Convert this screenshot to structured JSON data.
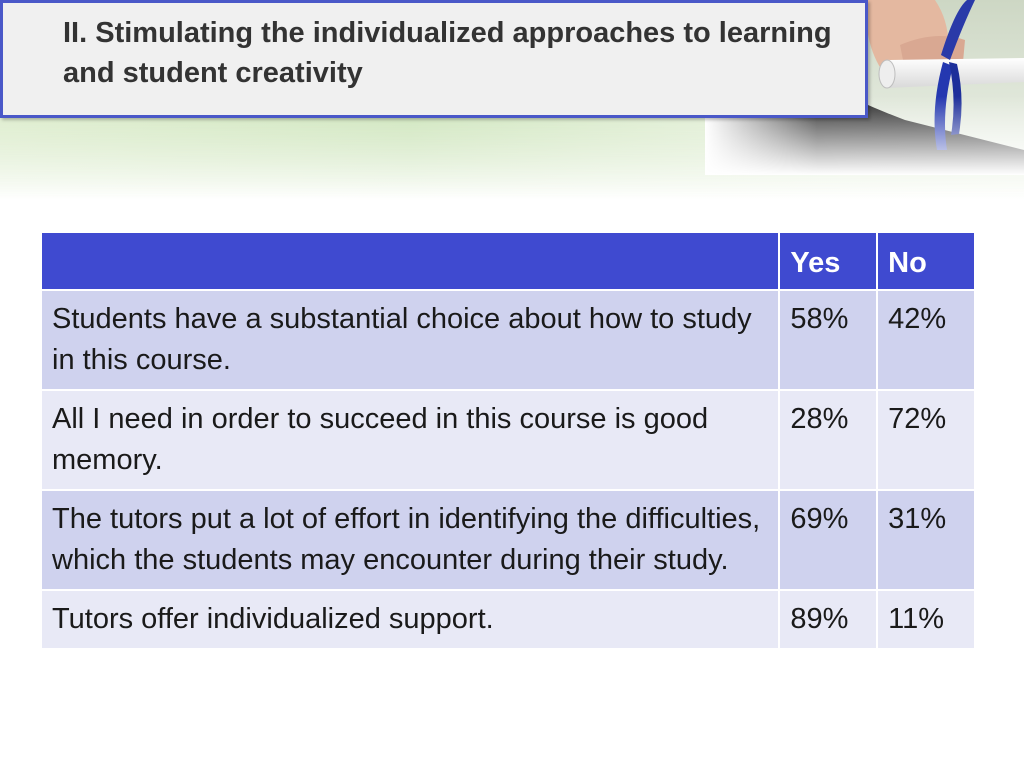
{
  "title": "II. Stimulating the individualized approaches to learning and student creativity",
  "table": {
    "headers": [
      "",
      "Yes",
      "No"
    ],
    "rows": [
      {
        "statement": "Students have a substantial choice about how to study in this course.",
        "yes": "58%",
        "no": "42%"
      },
      {
        "statement": "All I need in order to succeed in this course is good memory.",
        "yes": "28%",
        "no": "72%"
      },
      {
        "statement": "The tutors put a lot of effort in identifying the difficulties, which the students may encounter during their study.",
        "yes": "69%",
        "no": "31%"
      },
      {
        "statement": "Tutors offer individualized support.",
        "yes": "89%",
        "no": "11%"
      }
    ]
  },
  "colors": {
    "header_bg": "#3f4ad0",
    "row_dark": "#cfd2ee",
    "row_light": "#e8e9f6",
    "title_border": "#4a58c8"
  },
  "icons": [
    "graduation-diploma-photo"
  ]
}
